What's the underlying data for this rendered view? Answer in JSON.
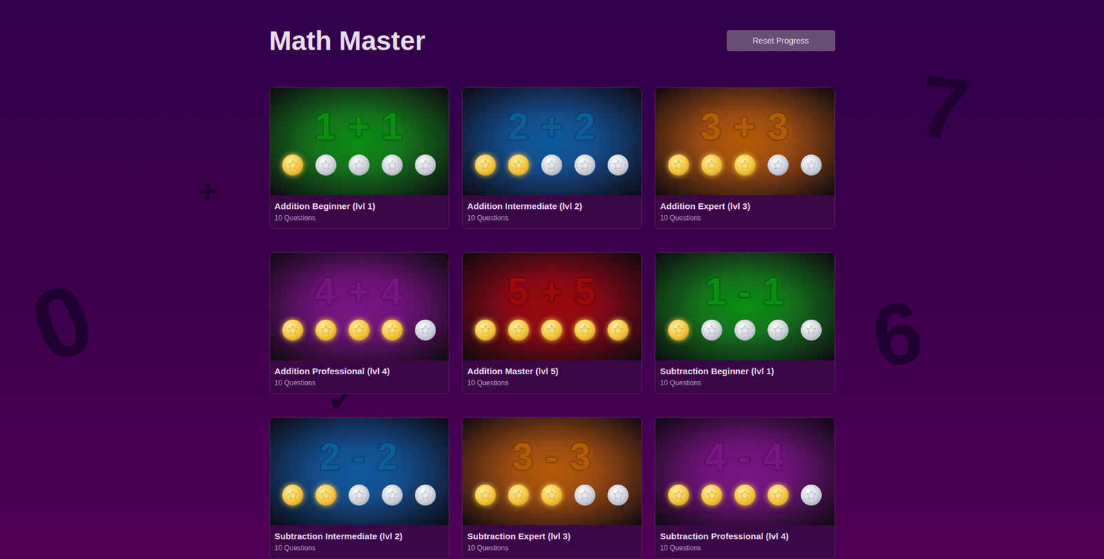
{
  "app": {
    "title": "Math Master",
    "button": "Reset Progress"
  },
  "background_symbols": [
    "7",
    "0",
    "6",
    "+",
    "✓"
  ],
  "levels": [
    {
      "expression": "1 + 1",
      "title": "Addition Beginner (lvl 1)",
      "subtitle": "10 Questions",
      "stars": 1,
      "color": "#0b8f12"
    },
    {
      "expression": "2 + 2",
      "title": "Addition Intermediate (lvl 2)",
      "subtitle": "10 Questions",
      "stars": 2,
      "color": "#0c5d9c"
    },
    {
      "expression": "3 + 3",
      "title": "Addition Expert (lvl 3)",
      "subtitle": "10 Questions",
      "stars": 3,
      "color": "#b35c06"
    },
    {
      "expression": "4 + 4",
      "title": "Addition Professional (lvl 4)",
      "subtitle": "10 Questions",
      "stars": 4,
      "color": "#7a1684"
    },
    {
      "expression": "5 + 5",
      "title": "Addition Master (lvl 5)",
      "subtitle": "10 Questions",
      "stars": 5,
      "color": "#9c0a0a"
    },
    {
      "expression": "1 - 1",
      "title": "Subtraction Beginner (lvl 1)",
      "subtitle": "10 Questions",
      "stars": 1,
      "color": "#0b8f12"
    },
    {
      "expression": "2 - 2",
      "title": "Subtraction Intermediate (lvl 2)",
      "subtitle": "10 Questions",
      "stars": 2,
      "color": "#0c5d9c"
    },
    {
      "expression": "3 - 3",
      "title": "Subtraction Expert (lvl 3)",
      "subtitle": "10 Questions",
      "stars": 3,
      "color": "#b35c06"
    },
    {
      "expression": "4 - 4",
      "title": "Subtraction Professional (lvl 4)",
      "subtitle": "10 Questions",
      "stars": 4,
      "color": "#7a1684"
    }
  ]
}
